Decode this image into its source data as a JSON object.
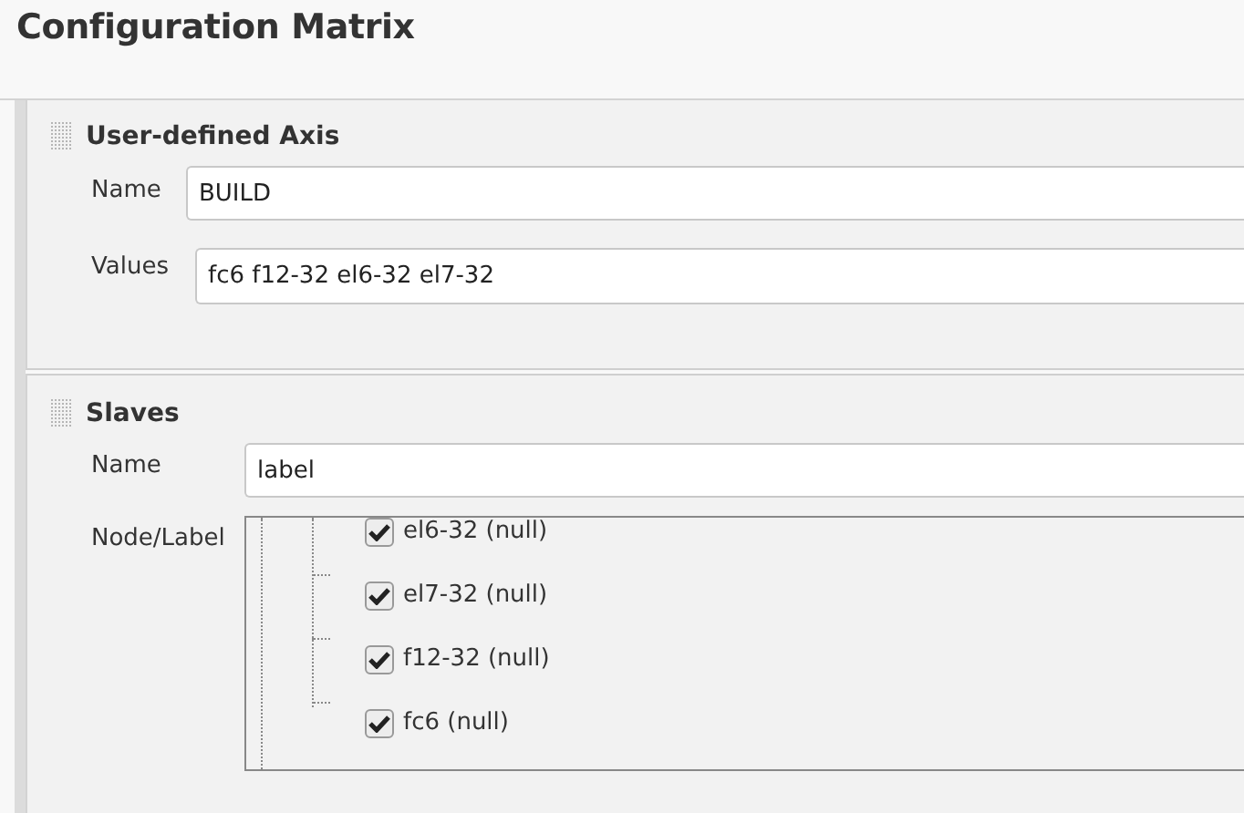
{
  "title": "Configuration Matrix",
  "axis": {
    "title": "User-defined Axis",
    "name_label": "Name",
    "name_value": "BUILD",
    "values_label": "Values",
    "values_value": "fc6 f12-32 el6-32 el7-32"
  },
  "slaves": {
    "title": "Slaves",
    "name_label": "Name",
    "name_value": "label",
    "tree_label": "Node/Label",
    "tree": [
      {
        "label": "el6-32 (null)",
        "checked": true
      },
      {
        "label": "el7-32 (null)",
        "checked": true
      },
      {
        "label": "f12-32 (null)",
        "checked": true
      },
      {
        "label": "fc6 (null)",
        "checked": true
      }
    ]
  }
}
